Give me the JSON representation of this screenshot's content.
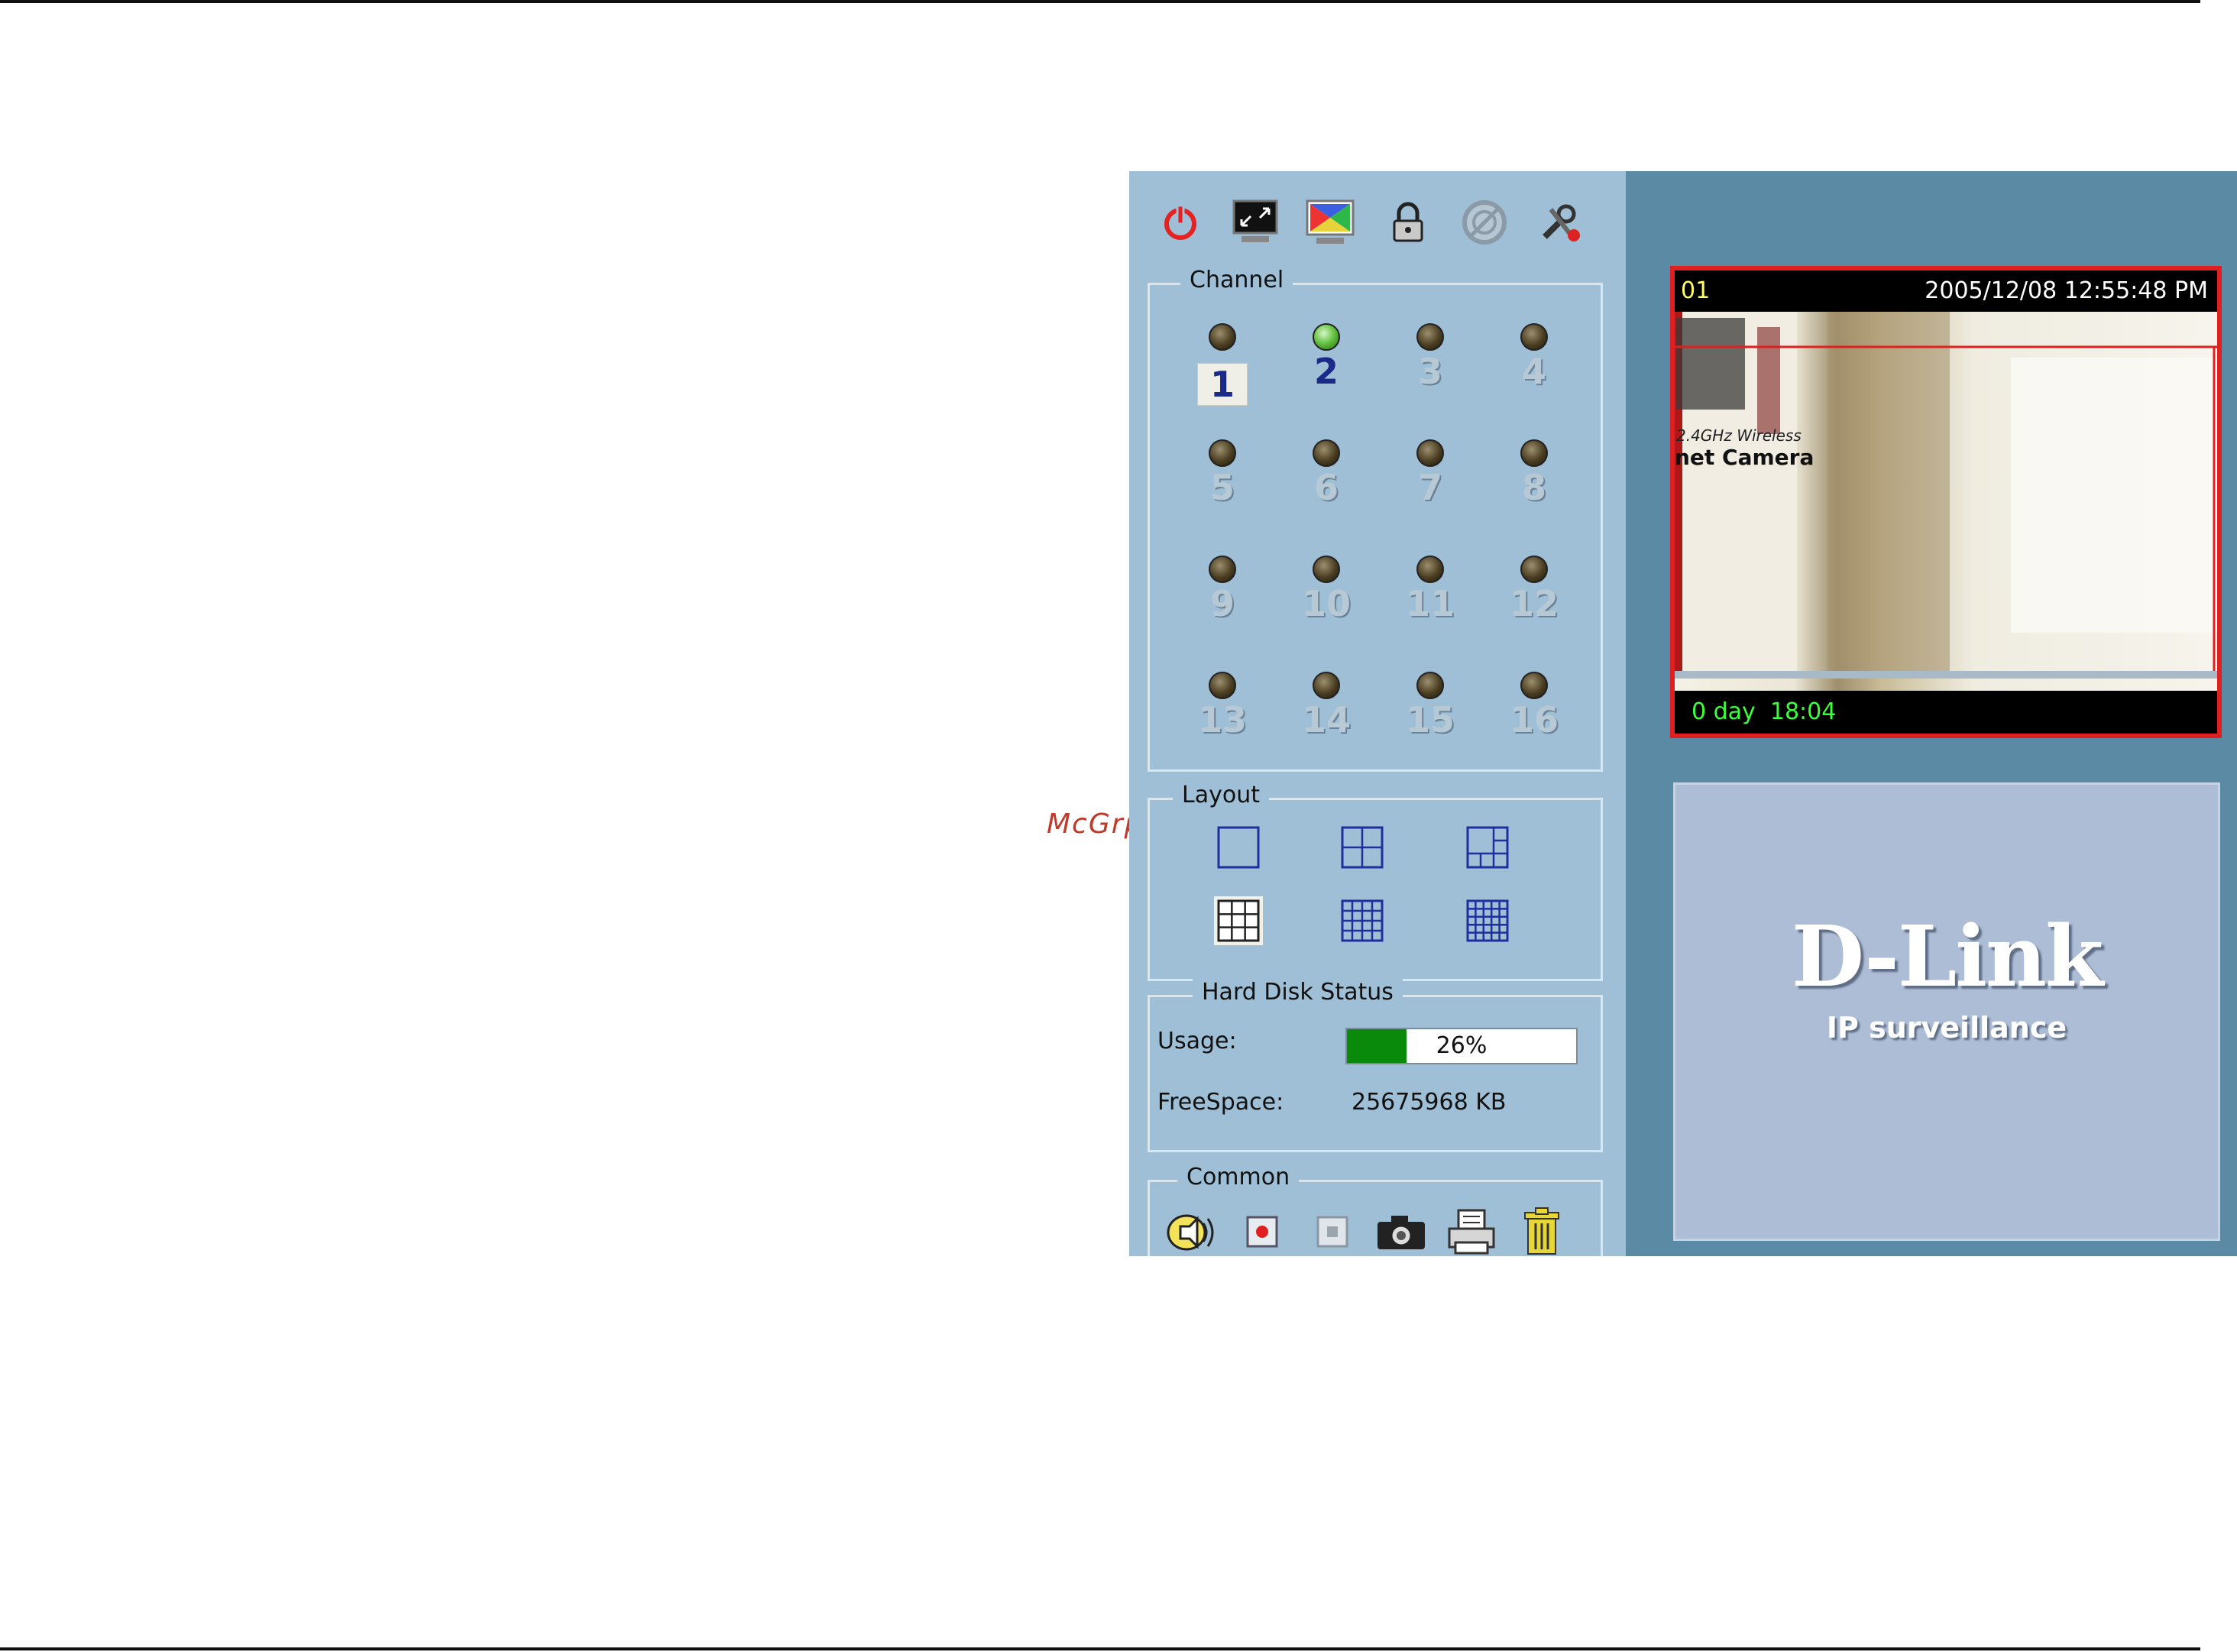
{
  "watermark": "McGrp.Ru",
  "toolbar": {
    "buttons": [
      {
        "name": "power-icon"
      },
      {
        "name": "monitor-icon"
      },
      {
        "name": "color-screen-icon"
      },
      {
        "name": "lock-icon"
      },
      {
        "name": "no-record-icon"
      },
      {
        "name": "settings-tools-icon"
      }
    ]
  },
  "channel": {
    "title": "Channel",
    "items": [
      {
        "label": "1",
        "active": false,
        "selected": true
      },
      {
        "label": "2",
        "active": true,
        "selected": false
      },
      {
        "label": "3",
        "active": false,
        "selected": false
      },
      {
        "label": "4",
        "active": false,
        "selected": false
      },
      {
        "label": "5",
        "active": false,
        "selected": false
      },
      {
        "label": "6",
        "active": false,
        "selected": false
      },
      {
        "label": "7",
        "active": false,
        "selected": false
      },
      {
        "label": "8",
        "active": false,
        "selected": false
      },
      {
        "label": "9",
        "active": false,
        "selected": false
      },
      {
        "label": "10",
        "active": false,
        "selected": false
      },
      {
        "label": "11",
        "active": false,
        "selected": false
      },
      {
        "label": "12",
        "active": false,
        "selected": false
      },
      {
        "label": "13",
        "active": false,
        "selected": false
      },
      {
        "label": "14",
        "active": false,
        "selected": false
      },
      {
        "label": "15",
        "active": false,
        "selected": false
      },
      {
        "label": "16",
        "active": false,
        "selected": false
      }
    ]
  },
  "layout": {
    "title": "Layout",
    "options": [
      {
        "name": "layout-1x1-icon",
        "grid": 1,
        "selected": false
      },
      {
        "name": "layout-2x2-icon",
        "grid": 2,
        "selected": false
      },
      {
        "name": "layout-1plus5-icon",
        "grid": 0,
        "selected": false
      },
      {
        "name": "layout-3x3-icon",
        "grid": 3,
        "selected": true
      },
      {
        "name": "layout-4x4-icon",
        "grid": 4,
        "selected": false
      },
      {
        "name": "layout-5x5-icon",
        "grid": 5,
        "selected": false
      }
    ]
  },
  "hard_disk": {
    "title": "Hard Disk Status",
    "usage_label": "Usage:",
    "usage_percent": 26,
    "usage_text": "26%",
    "free_label": "FreeSpace:",
    "free_value": "25675968 KB"
  },
  "common": {
    "title": "Common",
    "buttons": [
      {
        "name": "speaker-icon"
      },
      {
        "name": "record-icon"
      },
      {
        "name": "stop-icon"
      },
      {
        "name": "camera-snapshot-icon"
      },
      {
        "name": "printer-icon"
      },
      {
        "name": "trash-icon"
      }
    ]
  },
  "camera": {
    "id": "01",
    "timestamp": "2005/12/08 12:55:48 PM",
    "uptime": "0 day  18:04",
    "poster_line1": "2.4GHz Wireless",
    "poster_line2": "net Camera"
  },
  "brand": {
    "logo": "D-Link",
    "tagline": "IP surveillance"
  },
  "colors": {
    "panel": "#9fbfd6",
    "view": "#5a8aa4",
    "tile_border": "#e02020",
    "usage_fill": "#0a8a0a",
    "active_channel": "#1b2a86"
  }
}
